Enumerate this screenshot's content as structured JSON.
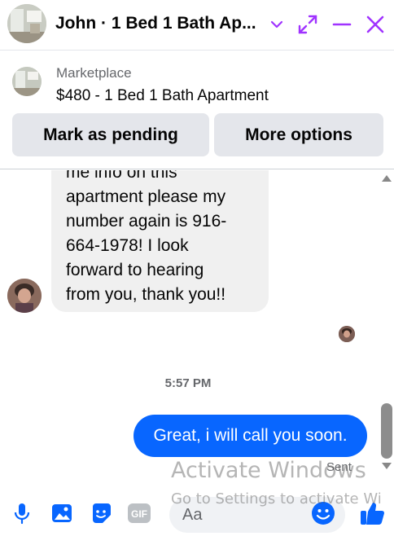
{
  "header": {
    "title": "John · 1 Bed 1 Bath Ap...",
    "accent_color": "#a033ff",
    "icons": [
      "chevron-down-icon",
      "expand-icon",
      "minimize-icon",
      "close-icon"
    ]
  },
  "marketplace": {
    "label": "Marketplace",
    "listing": "$480 - 1 Bed 1 Bath Apartment",
    "pending_button": "Mark as pending",
    "more_button": "More options"
  },
  "conversation": {
    "incoming_lines": [
      "me info on this",
      "apartment please my",
      "number again is 916-",
      "664-1978! I look",
      "forward to hearing",
      "from you, thank you!!"
    ],
    "timestamp": "5:57 PM",
    "outgoing_message": "Great, i will call you soon.",
    "outgoing_color": "#0866ff",
    "status": "Sent"
  },
  "composer": {
    "placeholder": "Aa",
    "icon_color": "#0866ff",
    "icons": [
      "microphone-icon",
      "photo-icon",
      "sticker-icon",
      "gif-icon",
      "emoji-icon",
      "thumbs-up-icon"
    ]
  },
  "watermark": {
    "line1": "Activate Windows",
    "line2": "Go to Settings to activate Wi"
  }
}
